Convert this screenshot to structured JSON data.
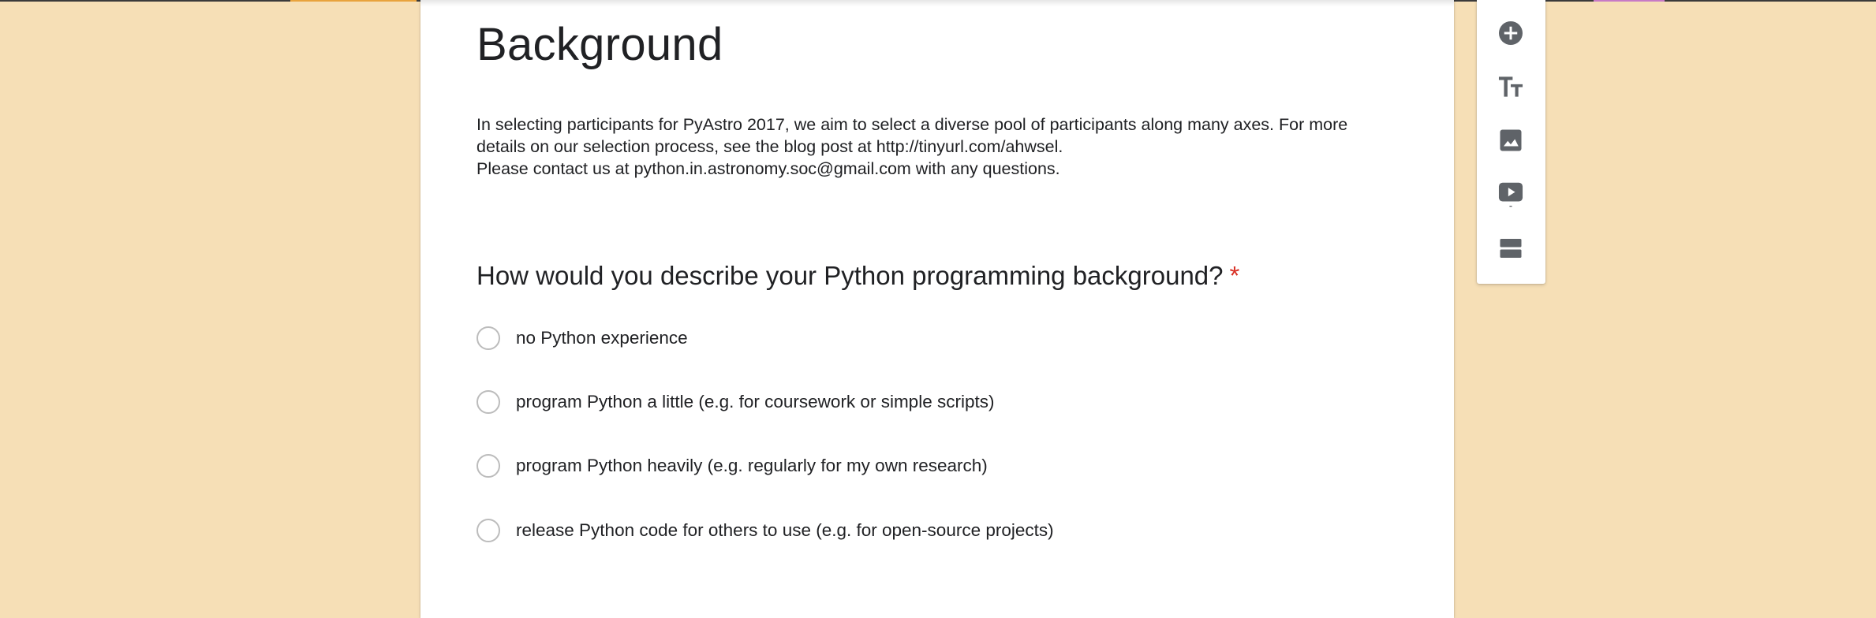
{
  "section": {
    "title": "Background",
    "description": [
      "In selecting participants for PyAstro 2017, we aim to select a diverse pool of participants along many axes. For more",
      "details on our selection process, see the blog post at http://tinyurl.com/ahwsel.",
      "Please contact us at python.in.astronomy.soc@gmail.com with any questions."
    ]
  },
  "question": {
    "text": "How would you describe your Python programming background?",
    "required_mark": "*",
    "options": [
      "no Python experience",
      "program Python a little (e.g. for coursework or simple scripts)",
      "program Python heavily (e.g. regularly for my own research)",
      "release Python code for others to use (e.g. for open-source projects)"
    ]
  },
  "toolbar": {
    "items": [
      {
        "icon": "add-circle-icon"
      },
      {
        "icon": "title-text-icon"
      },
      {
        "icon": "image-icon"
      },
      {
        "icon": "video-icon"
      },
      {
        "icon": "section-icon"
      }
    ]
  },
  "colors": {
    "background": "#f6dfb6",
    "card": "#ffffff",
    "required": "#d93025",
    "icon": "#5f6368",
    "radio_border": "#bcbcbc"
  }
}
